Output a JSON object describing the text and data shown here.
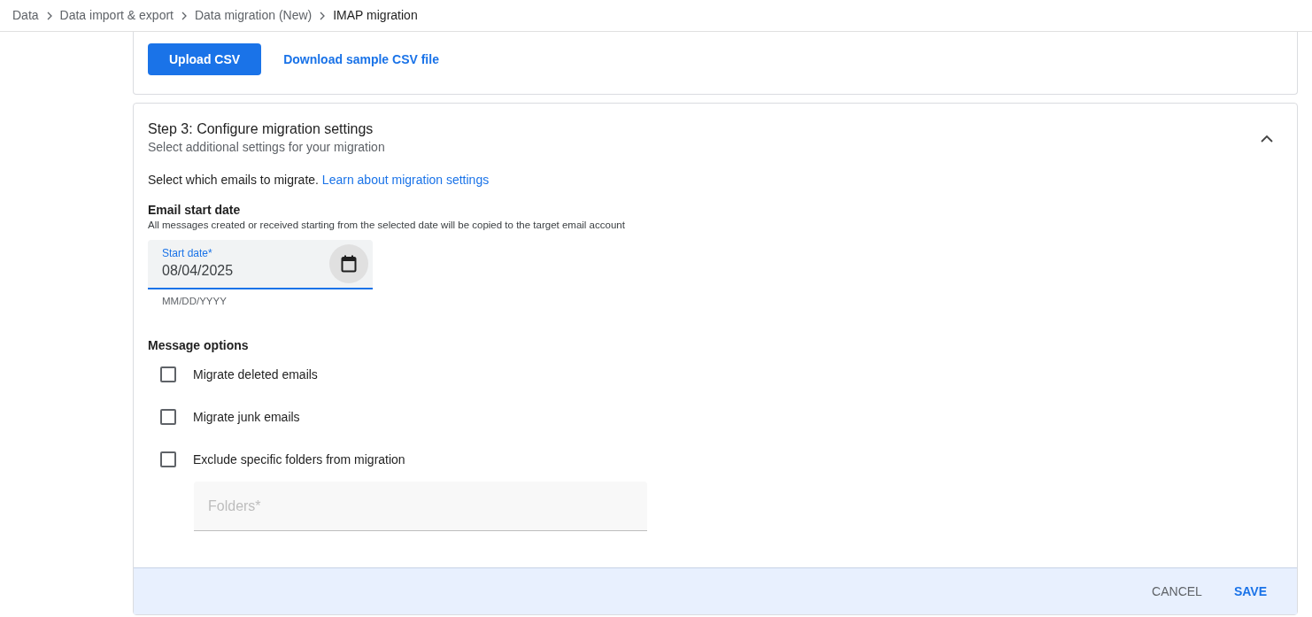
{
  "breadcrumbs": [
    {
      "label": "Data",
      "current": false
    },
    {
      "label": "Data import & export",
      "current": false
    },
    {
      "label": "Data migration (New)",
      "current": false
    },
    {
      "label": "IMAP migration",
      "current": true
    }
  ],
  "upload_card": {
    "upload_button": "Upload CSV",
    "sample_link": "Download sample CSV file"
  },
  "step": {
    "title": "Step 3: Configure migration settings",
    "subtitle": "Select additional settings for your migration",
    "expanded": true,
    "intro": "Select which emails to migrate.",
    "intro_link": "Learn about migration settings",
    "start_date": {
      "heading": "Email start date",
      "description": "All messages created or received starting from the selected date will be copied to the target email account",
      "label": "Start date*",
      "value": "08/04/2025",
      "hint": "MM/DD/YYYY"
    },
    "message_options": {
      "heading": "Message options",
      "options": [
        {
          "label": "Migrate deleted emails",
          "checked": false
        },
        {
          "label": "Migrate junk emails",
          "checked": false
        },
        {
          "label": "Exclude specific folders from migration",
          "checked": false
        }
      ]
    },
    "folders": {
      "placeholder": "Folders*",
      "disabled": true
    },
    "buttons": [
      {
        "label": "CANCEL",
        "kind": "secondary"
      },
      {
        "label": "SAVE",
        "kind": "primary"
      }
    ]
  }
}
